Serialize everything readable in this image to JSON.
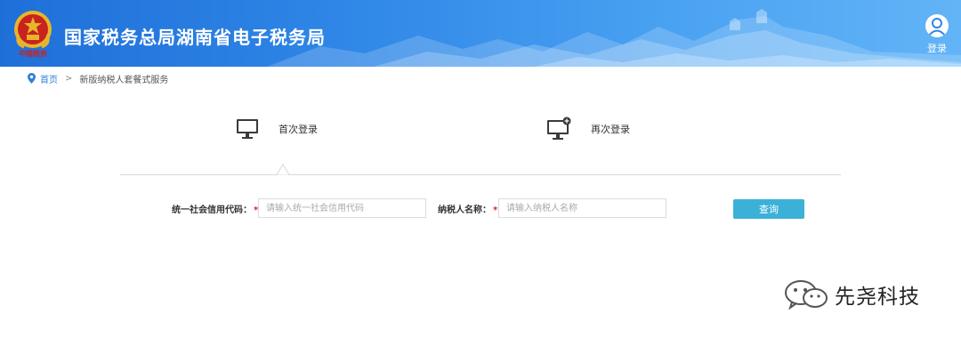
{
  "header": {
    "site_title": "国家税务总局湖南省电子税务局",
    "emblem_caption": "中国税务",
    "login_label": "登录",
    "colors": {
      "banner_start": "#1f6fd9",
      "banner_end": "#62b4f6",
      "emblem_red": "#c8231f",
      "emblem_gold": "#e8b52a"
    }
  },
  "breadcrumb": {
    "home_label": "首页",
    "separator": ">",
    "current": "新版纳税人套餐式服务"
  },
  "tabs": [
    {
      "label": "首次登录",
      "icon": "monitor-icon",
      "active": true
    },
    {
      "label": "再次登录",
      "icon": "monitor-plus-icon",
      "active": false
    }
  ],
  "form": {
    "credit_code_label": "统一社会信用代码：",
    "credit_code_placeholder": "请输入统一社会信用代码",
    "taxpayer_name_label": "纳税人名称：",
    "taxpayer_name_placeholder": "请输入纳税人名称",
    "required_mark": "*",
    "query_button": "查询",
    "colors": {
      "button": "#3cb1d8",
      "required": "#e02020"
    }
  },
  "watermark": {
    "text": "先尧科技",
    "icon": "wechat-icon"
  }
}
